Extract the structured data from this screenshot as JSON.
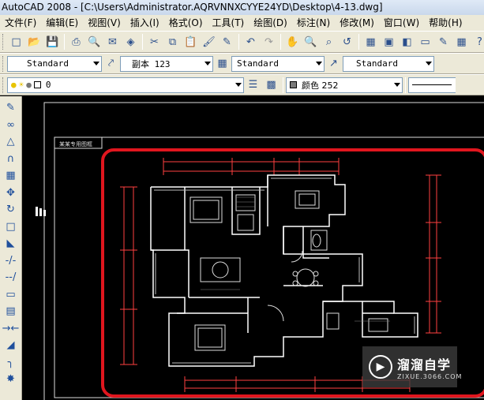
{
  "window": {
    "title": "AutoCAD 2008 - [C:\\Users\\Administrator.AQRVNNXCYYE24YD\\Desktop\\4-13.dwg]"
  },
  "menu": [
    "文件(F)",
    "编辑(E)",
    "视图(V)",
    "插入(I)",
    "格式(O)",
    "工具(T)",
    "绘图(D)",
    "标注(N)",
    "修改(M)",
    "窗口(W)",
    "帮助(H)"
  ],
  "styles": {
    "text_style": "Standard",
    "dim_style": "副本 123",
    "table_style": "Standard",
    "multileader_style": "Standard"
  },
  "layers": {
    "current": "0"
  },
  "properties": {
    "color_label": "颜色 252"
  },
  "drawing": {
    "title_label": "某某专用图框"
  },
  "watermark": {
    "brand": "溜溜自学",
    "url": "ZIXUE.3066.COM"
  },
  "colors": {
    "highlight": "#e0161e",
    "drawing_lines": "#ffffff",
    "dimension": "#ff3b3b"
  }
}
